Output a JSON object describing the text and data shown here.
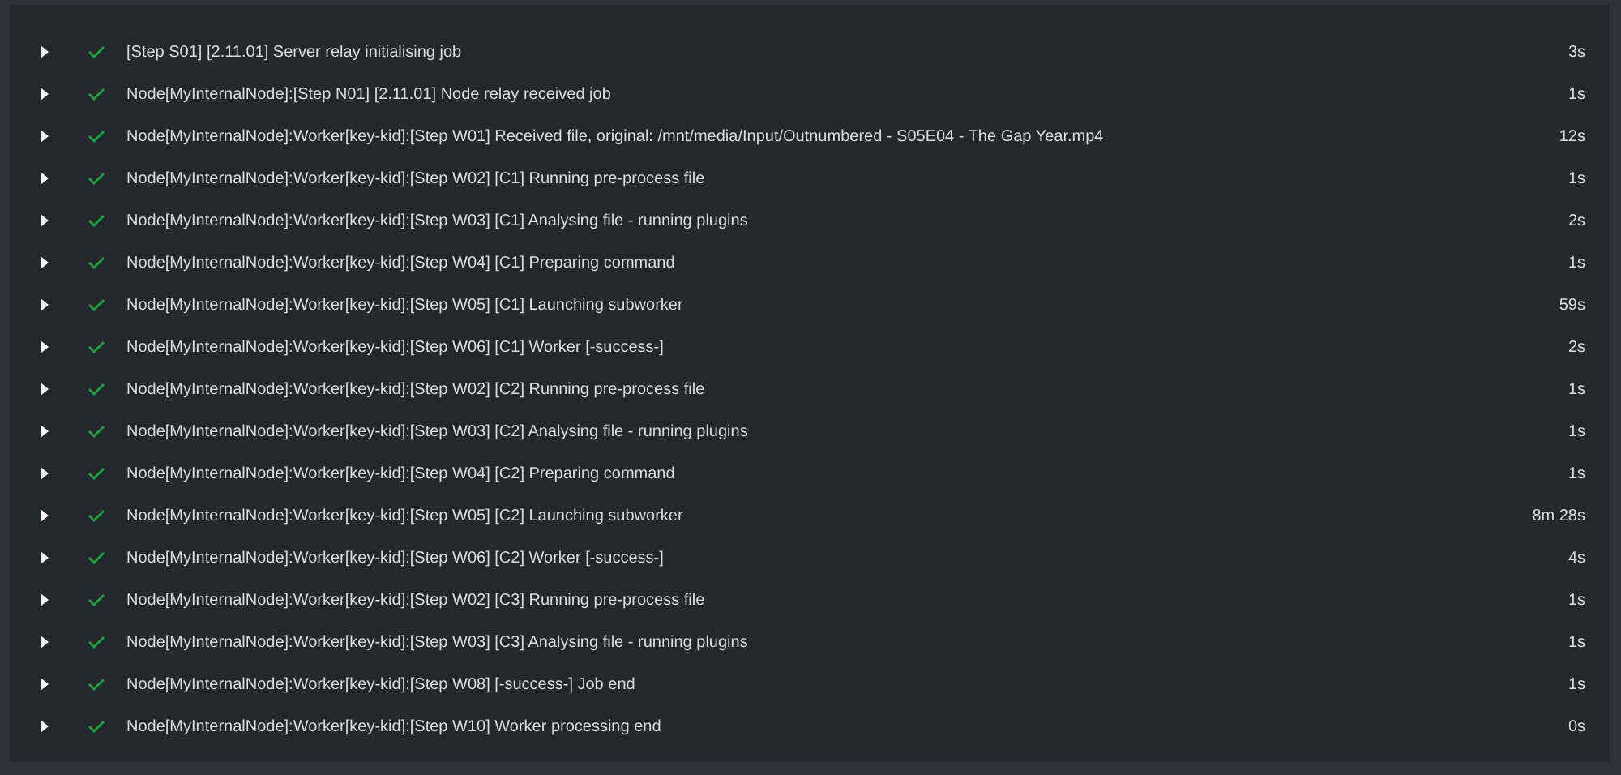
{
  "log_steps": [
    {
      "expanded": false,
      "kind": "success",
      "message": "[Step S01] [2.11.01] Server relay initialising job",
      "duration": "3s"
    },
    {
      "expanded": false,
      "kind": "success",
      "message": "Node[MyInternalNode]:[Step N01] [2.11.01] Node relay received job",
      "duration": "1s"
    },
    {
      "expanded": false,
      "kind": "success",
      "message": "Node[MyInternalNode]:Worker[key-kid]:[Step W01] Received file, original: /mnt/media/Input/Outnumbered - S05E04 - The Gap Year.mp4",
      "duration": "12s"
    },
    {
      "expanded": false,
      "kind": "success",
      "message": "Node[MyInternalNode]:Worker[key-kid]:[Step W02] [C1] Running pre-process file",
      "duration": "1s"
    },
    {
      "expanded": false,
      "kind": "success",
      "message": "Node[MyInternalNode]:Worker[key-kid]:[Step W03] [C1] Analysing file - running plugins",
      "duration": "2s"
    },
    {
      "expanded": false,
      "kind": "success",
      "message": "Node[MyInternalNode]:Worker[key-kid]:[Step W04] [C1] Preparing command",
      "duration": "1s"
    },
    {
      "expanded": false,
      "kind": "success",
      "message": "Node[MyInternalNode]:Worker[key-kid]:[Step W05] [C1] Launching subworker",
      "duration": "59s"
    },
    {
      "expanded": false,
      "kind": "success",
      "message": "Node[MyInternalNode]:Worker[key-kid]:[Step W06] [C1] Worker [-success-]",
      "duration": "2s"
    },
    {
      "expanded": false,
      "kind": "success",
      "message": "Node[MyInternalNode]:Worker[key-kid]:[Step W02] [C2] Running pre-process file",
      "duration": "1s"
    },
    {
      "expanded": false,
      "kind": "success",
      "message": "Node[MyInternalNode]:Worker[key-kid]:[Step W03] [C2] Analysing file - running plugins",
      "duration": "1s"
    },
    {
      "expanded": false,
      "kind": "success",
      "message": "Node[MyInternalNode]:Worker[key-kid]:[Step W04] [C2] Preparing command",
      "duration": "1s"
    },
    {
      "expanded": false,
      "kind": "success",
      "message": "Node[MyInternalNode]:Worker[key-kid]:[Step W05] [C2] Launching subworker",
      "duration": "8m 28s"
    },
    {
      "expanded": false,
      "kind": "success",
      "message": "Node[MyInternalNode]:Worker[key-kid]:[Step W06] [C2] Worker [-success-]",
      "duration": "4s"
    },
    {
      "expanded": false,
      "kind": "success",
      "message": "Node[MyInternalNode]:Worker[key-kid]:[Step W02] [C3] Running pre-process file",
      "duration": "1s"
    },
    {
      "expanded": false,
      "kind": "success",
      "message": "Node[MyInternalNode]:Worker[key-kid]:[Step W03] [C3] Analysing file - running plugins",
      "duration": "1s"
    },
    {
      "expanded": false,
      "kind": "success",
      "message": "Node[MyInternalNode]:Worker[key-kid]:[Step W08] [-success-] Job end",
      "duration": "1s"
    },
    {
      "expanded": false,
      "kind": "success",
      "message": "Node[MyInternalNode]:Worker[key-kid]:[Step W10] Worker processing end",
      "duration": "0s"
    }
  ]
}
